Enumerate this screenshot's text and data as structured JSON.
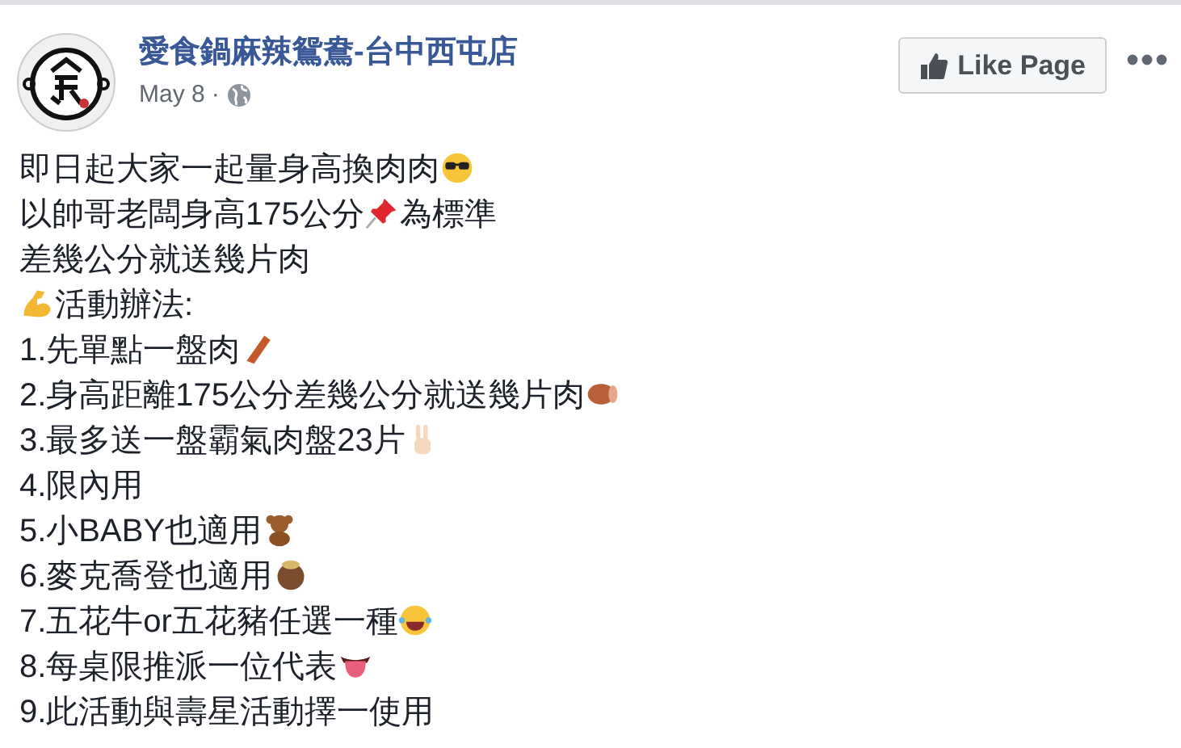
{
  "page": {
    "name": "愛食鍋麻辣鴛鴦-台中西屯店",
    "date": "May 8",
    "separator": "·"
  },
  "like_button": {
    "label": "Like Page"
  },
  "post_lines": [
    {
      "parts": [
        {
          "kind": "text",
          "text": "即日起大家一起量身高換肉肉"
        },
        {
          "kind": "sunglasses"
        }
      ]
    },
    {
      "parts": [
        {
          "kind": "text",
          "text": "以帥哥老闆身高175公分"
        },
        {
          "kind": "pin"
        },
        {
          "kind": "text",
          "text": "為標準"
        }
      ]
    },
    {
      "parts": [
        {
          "kind": "text",
          "text": "差幾公分就送幾片肉"
        }
      ]
    },
    {
      "parts": [
        {
          "kind": "muscle"
        },
        {
          "kind": "text",
          "text": "活動辦法:"
        }
      ]
    },
    {
      "parts": [
        {
          "kind": "text",
          "text": "1.先單點一盤肉"
        },
        {
          "kind": "bacon"
        }
      ]
    },
    {
      "parts": [
        {
          "kind": "text",
          "text": "2.身高距離175公分差幾公分就送幾片肉"
        },
        {
          "kind": "meat"
        }
      ]
    },
    {
      "parts": [
        {
          "kind": "text",
          "text": "3.最多送一盤霸氣肉盤23片"
        },
        {
          "kind": "peace"
        }
      ]
    },
    {
      "parts": [
        {
          "kind": "text",
          "text": "4.限內用"
        }
      ]
    },
    {
      "parts": [
        {
          "kind": "text",
          "text": "5.小BABY也適用"
        },
        {
          "kind": "bear"
        }
      ]
    },
    {
      "parts": [
        {
          "kind": "text",
          "text": "6.麥克喬登也適用"
        },
        {
          "kind": "baby"
        }
      ]
    },
    {
      "parts": [
        {
          "kind": "text",
          "text": "7.五花牛or五花豬任選一種"
        },
        {
          "kind": "laugh"
        }
      ]
    },
    {
      "parts": [
        {
          "kind": "text",
          "text": "8.每桌限推派一位代表"
        },
        {
          "kind": "tongue"
        }
      ]
    },
    {
      "parts": [
        {
          "kind": "text",
          "text": "9.此活動與壽星活動擇一使用"
        }
      ]
    }
  ]
}
